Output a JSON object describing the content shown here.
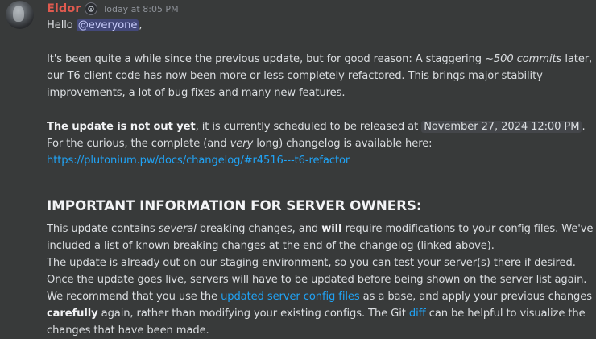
{
  "author": {
    "name": "Eldor",
    "timestamp": "Today at 8:05 PM"
  },
  "greeting": {
    "hello": "Hello ",
    "mention": "@everyone",
    "comma": ","
  },
  "p1": {
    "l1_a": "It's been quite a while since the previous update, but for good reason: A staggering ",
    "l1_em": "~500 commits",
    "l1_b": " later,",
    "l2": "our T6 client code has now been more or less completely refactored. This brings major stability",
    "l3": "improvements, a lot of bug fixes and many new features."
  },
  "p2": {
    "bold": "The update is not out yet",
    "l1_a": ", it is currently scheduled to be released at ",
    "release_time": "November 27, 2024 12:00 PM",
    "l1_b": ".",
    "l2_a": "For the curious, the complete (and ",
    "l2_em": "very",
    "l2_b": " long) changelog is available here:",
    "link": "https://plutonium.pw/docs/changelog/#r4516---t6-refactor"
  },
  "heading": "IMPORTANT INFORMATION FOR SERVER OWNERS:",
  "p3": {
    "l1_a": "This update contains ",
    "l1_em": "several",
    "l1_b": " breaking changes, and ",
    "l1_bold": "will",
    "l1_c": " require modifications to your config files. We've",
    "l2": "included a list of known breaking changes at the end of the changelog (linked above).",
    "l3": "The update is already out on our staging environment, so you can test your server(s) there if desired.",
    "l4": "Once the update goes live, servers will have to be updated before being shown on the server list again.",
    "l5_a": "We recommend that you use the ",
    "l5_link": "updated server config files",
    "l5_b": " as a base, and apply your previous changes",
    "l6_bold": "carefully",
    "l6_a": " again, rather than modifying your existing configs. The Git ",
    "l6_link": "diff",
    "l6_b": " can be helpful to visualize the",
    "l7": "changes that have been made."
  }
}
